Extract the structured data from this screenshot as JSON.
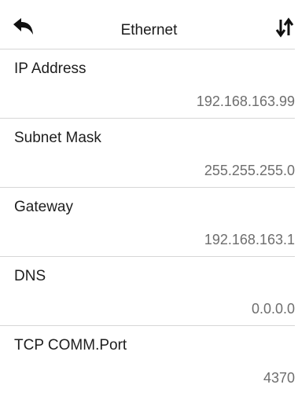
{
  "header": {
    "title": "Ethernet",
    "back_icon": "back-arrow-icon",
    "sort_icon": "sort-arrows-icon"
  },
  "settings": [
    {
      "label": "IP Address",
      "value": "192.168.163.99"
    },
    {
      "label": "Subnet Mask",
      "value": "255.255.255.0"
    },
    {
      "label": "Gateway",
      "value": "192.168.163.1"
    },
    {
      "label": "DNS",
      "value": "0.0.0.0"
    },
    {
      "label": "TCP COMM.Port",
      "value": "4370"
    }
  ],
  "colors": {
    "background": "#ffffff",
    "text": "#1e1e1e",
    "value_text": "#6e6e6e",
    "divider": "#d6d6d6"
  }
}
